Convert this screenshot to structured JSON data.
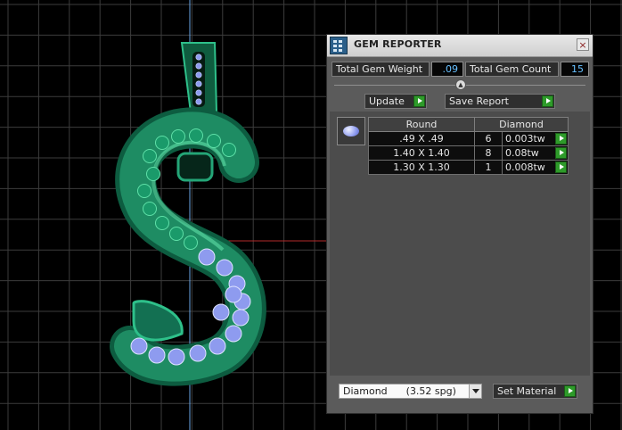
{
  "panel": {
    "title": "GEM REPORTER",
    "close_label": "×",
    "total_gem_weight_label": "Total Gem Weight",
    "total_gem_weight_value": ".09",
    "total_gem_count_label": "Total Gem Count",
    "total_gem_count_value": "15",
    "update_label": "Update",
    "save_report_label": "Save Report"
  },
  "gem_table": {
    "headers": [
      "Round",
      "Diamond"
    ],
    "rows": [
      {
        "size": ".49 X .49",
        "count": "6",
        "weight": "0.003tw"
      },
      {
        "size": "1.40 X 1.40",
        "count": "8",
        "weight": "0.08tw"
      },
      {
        "size": "1.30 X 1.30",
        "count": "1",
        "weight": "0.008tw"
      }
    ]
  },
  "material": {
    "selected": "Diamond      (3.52 spg)",
    "set_material_label": "Set Material"
  },
  "colors": {
    "viewport_bg": "#000000",
    "grid_line": "#3c3c3c",
    "axis_blue": "#6aa6e6",
    "axis_red": "#b42a2a",
    "metal_green": "#1e8c63",
    "gem_blue": "#8e9bef",
    "panel_bg": "#5b5b5b",
    "value_text": "#67c0ff",
    "play_green": "#2e9b2a"
  }
}
